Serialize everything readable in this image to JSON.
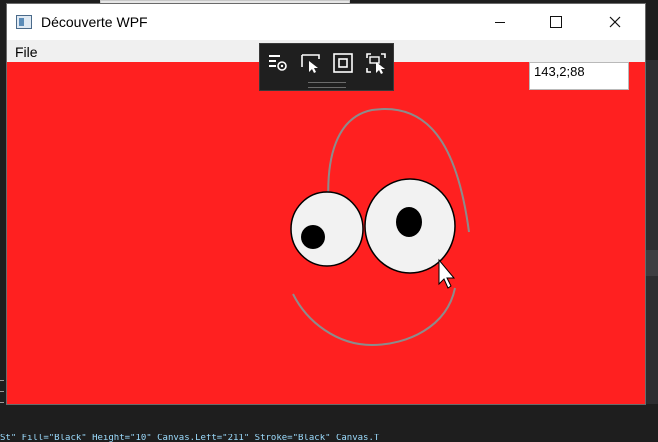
{
  "window": {
    "title": "Découverte WPF",
    "icon": "app-window-icon",
    "controls": {
      "minimize_icon": "minimize-icon",
      "maximize_icon": "maximize-icon",
      "close_icon": "close-icon"
    }
  },
  "menu": {
    "items": [
      {
        "label": "File"
      }
    ]
  },
  "canvas": {
    "background_color": "#ff2020",
    "coordinates_text": "143,2;88"
  },
  "debug_toolbar": {
    "buttons": [
      {
        "icon": "visual-tree-icon"
      },
      {
        "icon": "select-element-icon"
      },
      {
        "icon": "display-layout-adorners-icon"
      },
      {
        "icon": "track-focus-icon"
      }
    ]
  },
  "background": {
    "code_snippet": "St\" Fill=\"Black\" Height=\"10\" Canvas.Left=\"211\" Stroke=\"Black\" Canvas.T"
  },
  "colors": {
    "eye_fill": "#f2f2f2",
    "pupil": "#000000",
    "curve": "#8c8c8c"
  }
}
